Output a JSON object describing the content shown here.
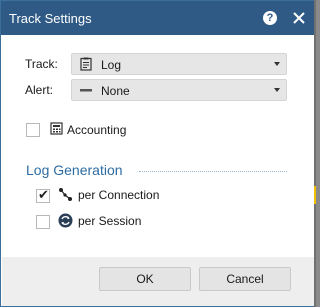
{
  "window": {
    "title": "Track Settings",
    "help_label": "?",
    "close_label": "✕"
  },
  "track": {
    "label": "Track:",
    "value": "Log",
    "icon": "log-document-icon"
  },
  "alert": {
    "label": "Alert:",
    "value": "None",
    "icon": "dash-icon"
  },
  "accounting": {
    "label": "Accounting",
    "checked": false,
    "icon": "calculator-icon"
  },
  "log_generation": {
    "title": "Log Generation",
    "options": [
      {
        "label": "per Connection",
        "checked": true,
        "icon": "connection-icon"
      },
      {
        "label": "per Session",
        "checked": false,
        "icon": "session-icon"
      }
    ]
  },
  "buttons": {
    "ok": "OK",
    "cancel": "Cancel"
  },
  "colors": {
    "titlebar": "#2f5a86",
    "accent": "#2d6ca2"
  }
}
